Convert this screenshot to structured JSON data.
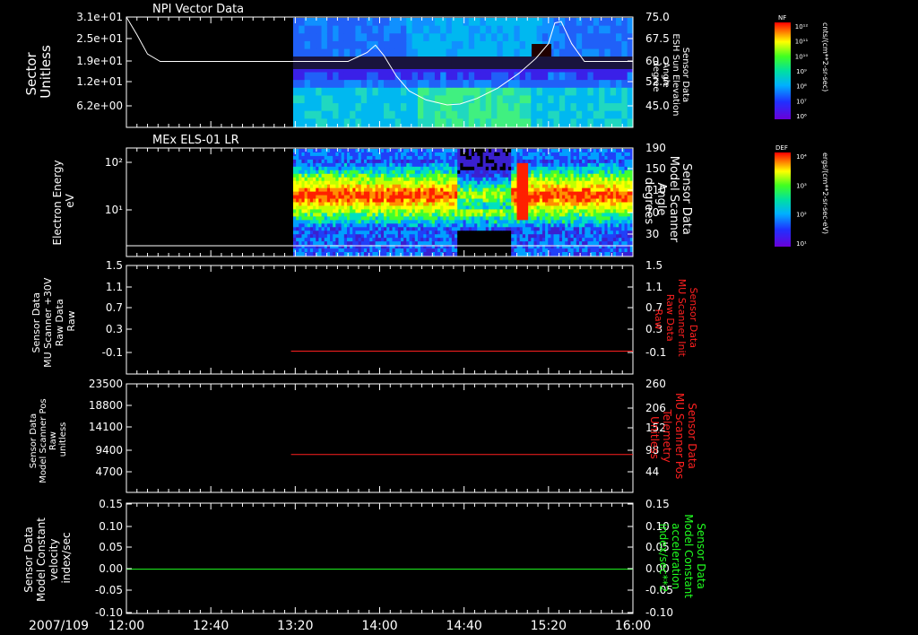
{
  "colors": {
    "background": "#000000",
    "axis": "#ffffff",
    "red_trace": "#ff2020",
    "green_trace": "#20ff20",
    "white_trace": "#ffffff"
  },
  "x_axis": {
    "date_label": "2007/109",
    "ticks": [
      "12:00",
      "12:40",
      "13:20",
      "14:00",
      "14:40",
      "15:20",
      "16:00"
    ],
    "range": [
      "12:00",
      "16:00"
    ]
  },
  "chart_data": [
    {
      "type": "heatmap",
      "panel_title": "NPI Vector Data",
      "ylabel_left": [
        "Sector",
        "Unitless"
      ],
      "ylabel_right": [
        "Sensor Data",
        "ESH Sun Elevation",
        "Angle",
        "degree"
      ],
      "y_ticks_left": [
        "3.1e+01",
        "2.5e+01",
        "1.9e+01",
        "1.2e+01",
        "6.2e+00"
      ],
      "y_ticks_right": [
        "75.0",
        "67.5",
        "60.0",
        "52.5",
        "45.0"
      ],
      "data_start": "13:19",
      "colorbar": {
        "label": "NF",
        "unit": "cnts/(cm**2-sr-sec)",
        "ticks": [
          "10¹²",
          "10¹¹",
          "10¹⁰",
          "10⁹",
          "10⁸",
          "10⁷",
          "10⁶"
        ]
      },
      "line_series": {
        "color": "white",
        "points": [
          [
            "12:00",
            75.0
          ],
          [
            "12:05",
            69.0
          ],
          [
            "12:10",
            62.5
          ],
          [
            "12:16",
            60.0
          ],
          [
            "13:45",
            60.0
          ],
          [
            "13:54",
            63.0
          ],
          [
            "13:58",
            65.5
          ],
          [
            "14:02",
            62.0
          ],
          [
            "14:08",
            55.0
          ],
          [
            "14:14",
            50.0
          ],
          [
            "14:22",
            47.0
          ],
          [
            "14:32",
            45.3
          ],
          [
            "14:38",
            45.6
          ],
          [
            "14:46",
            47.5
          ],
          [
            "14:56",
            51.0
          ],
          [
            "15:06",
            56.0
          ],
          [
            "15:14",
            61.0
          ],
          [
            "15:20",
            66.0
          ],
          [
            "15:23",
            73.0
          ],
          [
            "15:26",
            73.5
          ],
          [
            "15:31",
            66.0
          ],
          [
            "15:37",
            60.0
          ],
          [
            "16:00",
            60.0
          ]
        ]
      }
    },
    {
      "type": "heatmap",
      "panel_title": "MEx ELS-01 LR",
      "ylabel_left": [
        "Electron Energy",
        "eV"
      ],
      "ylabel_right": [
        "Sensor Data",
        "Model Scanner",
        "Angle",
        "degrees"
      ],
      "y_ticks_left": [
        "10²",
        "10¹"
      ],
      "y_ticks_right": [
        "190",
        "150",
        "110",
        "70",
        "30"
      ],
      "data_start": "13:19",
      "colorbar": {
        "label": "DEF",
        "unit": "ergs/(cm**2-sr-sec-eV)",
        "ticks": [
          "10⁴",
          "10³",
          "10²",
          "10¹"
        ]
      },
      "line_series": {
        "color": "white",
        "points": [
          [
            "12:00",
            5
          ],
          [
            "16:00",
            5
          ]
        ]
      }
    },
    {
      "type": "line",
      "ylabel_left": [
        "Sensor Data",
        "MU Scanner +30V",
        "Raw Data",
        "Raw"
      ],
      "ylabel_right": [
        "Sensor Data",
        "MU Scanner Init",
        "Raw Data",
        "Raw"
      ],
      "y_ticks_left": [
        "1.5",
        "1.1",
        "0.7",
        "0.3",
        "-0.1"
      ],
      "y_ticks_right": [
        "1.5",
        "1.1",
        "0.7",
        "0.3",
        "-0.1"
      ],
      "ylim": [
        -0.4,
        1.5
      ],
      "series": [
        {
          "color": "red",
          "x_start": "13:18",
          "x_end": "16:00",
          "value": 0.0
        }
      ]
    },
    {
      "type": "line",
      "ylabel_left": [
        "Sensor Data",
        "Model Scanner Pos",
        "Raw",
        "unitless"
      ],
      "ylabel_right": [
        "Sensor Data",
        "MU Scanner Pos",
        "Telemetry",
        "Unitless"
      ],
      "y_ticks_left": [
        "23500",
        "18800",
        "14100",
        "9400",
        "4700"
      ],
      "y_ticks_right": [
        "260",
        "206",
        "152",
        "98",
        "44"
      ],
      "ylim": [
        0,
        23500
      ],
      "series": [
        {
          "color": "red",
          "x_start": "13:18",
          "x_end": "16:00",
          "value": 8200
        }
      ]
    },
    {
      "type": "line",
      "ylabel_left": [
        "Sensor Data",
        "Model Constant",
        "velocity",
        "index/sec"
      ],
      "ylabel_right": [
        "Sensor Data",
        "Model Constant",
        "acceleration",
        "index/sec**2"
      ],
      "y_ticks_left": [
        "0.15",
        "0.10",
        "0.05",
        "0.00",
        "-0.05",
        "-0.10"
      ],
      "y_ticks_right": [
        "0.15",
        "0.10",
        "0.05",
        "0.00",
        "-0.05",
        "-0.10"
      ],
      "ylim": [
        -0.1,
        0.15
      ],
      "series": [
        {
          "color": "green",
          "x_start": "12:00",
          "x_end": "16:00",
          "value": 0.0
        }
      ]
    }
  ]
}
